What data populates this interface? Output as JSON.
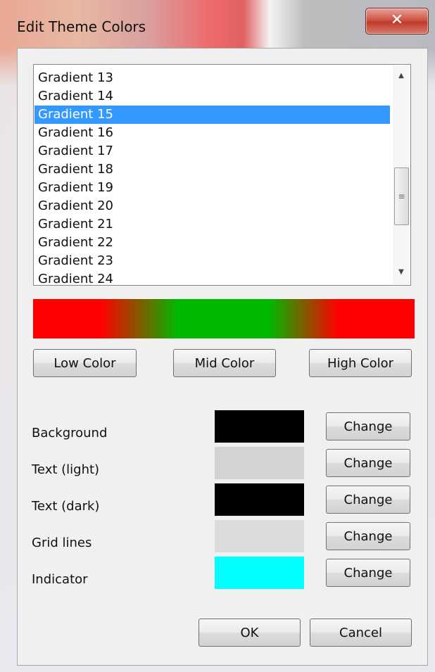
{
  "window": {
    "title": "Edit Theme Colors",
    "close_glyph": "✕"
  },
  "gradient_list": {
    "items": [
      "Gradient 13",
      "Gradient 14",
      "Gradient 15",
      "Gradient 16",
      "Gradient 17",
      "Gradient 18",
      "Gradient 19",
      "Gradient 20",
      "Gradient 21",
      "Gradient 22",
      "Gradient 23",
      "Gradient 24"
    ],
    "selected": "Gradient 15"
  },
  "scrollbar": {
    "up_glyph": "▲",
    "down_glyph": "▼",
    "grip_glyph": "≡"
  },
  "gradient_preview": {
    "low": "#ff0000",
    "mid": "#00b800",
    "high": "#ff0000"
  },
  "gradient_buttons": {
    "low": "Low Color",
    "mid": "Mid Color",
    "high": "High Color"
  },
  "theme_colors": [
    {
      "label": "Background",
      "color": "#000000",
      "button": "Change"
    },
    {
      "label": "Text (light)",
      "color": "#d3d3d3",
      "button": "Change"
    },
    {
      "label": "Text (dark)",
      "color": "#000000",
      "button": "Change"
    },
    {
      "label": "Grid lines",
      "color": "#dcdcdc",
      "button": "Change"
    },
    {
      "label": "Indicator",
      "color": "#00ffff",
      "button": "Change"
    }
  ],
  "footer": {
    "ok": "OK",
    "cancel": "Cancel"
  }
}
